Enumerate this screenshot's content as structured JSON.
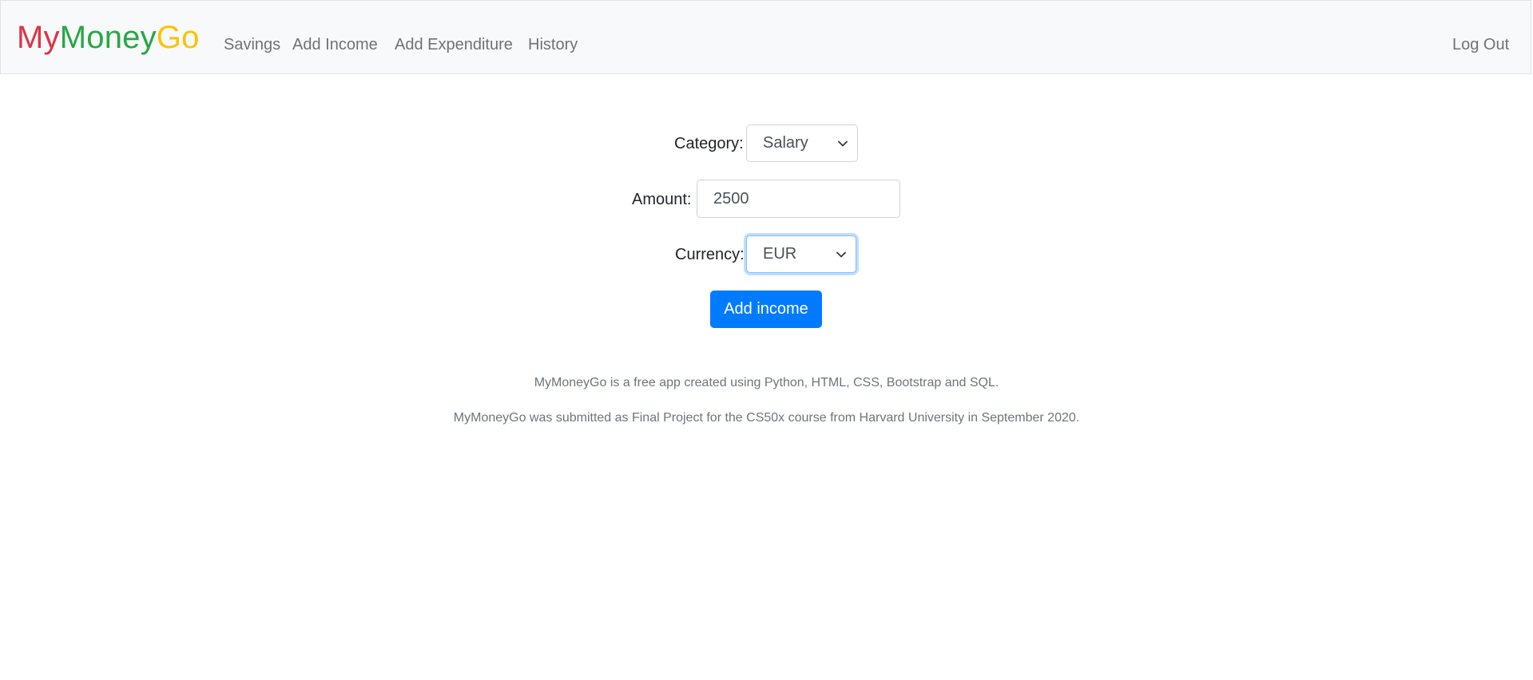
{
  "brand": {
    "part1": "My",
    "part2": "Money",
    "part3": "Go",
    "colors": {
      "my": "#dc3545",
      "money": "#28a745",
      "go": "#ffc107"
    }
  },
  "nav": {
    "items": [
      "Savings",
      "Add Income",
      "Add Expenditure",
      "History"
    ],
    "logout": "Log Out"
  },
  "form": {
    "category_label": "Category:",
    "category_value": "Salary",
    "amount_label": "Amount:",
    "amount_value": "2500",
    "currency_label": "Currency:",
    "currency_value": "EUR",
    "submit_label": "Add income"
  },
  "footer": {
    "line1": "MyMoneyGo is a free app created using Python, HTML, CSS, Bootstrap and SQL.",
    "line2": "MyMoneyGo was submitted as Final Project for the CS50x course from Harvard University in September 2020."
  },
  "colors": {
    "primary": "#007bff",
    "navbar_bg": "#f8f9fa",
    "muted_text": "#6c757d"
  },
  "icons": {
    "select_arrow": "chevron-down-icon"
  }
}
